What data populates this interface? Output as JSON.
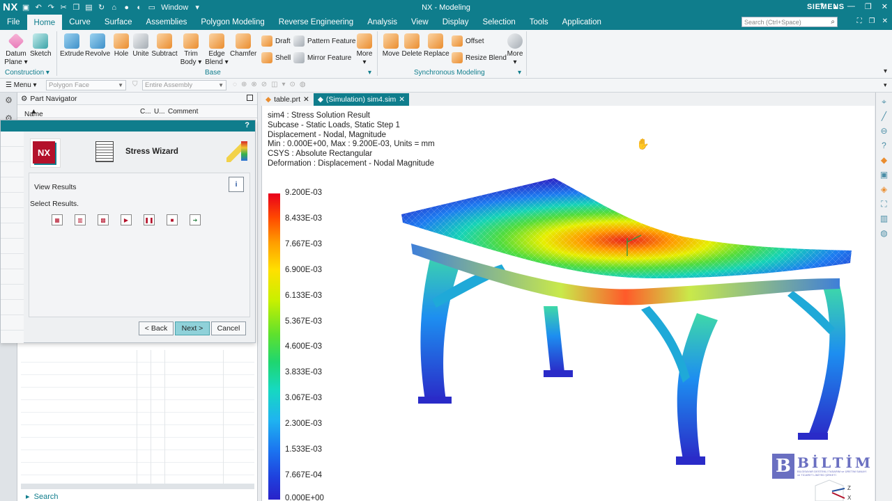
{
  "titlebar": {
    "logo": "NX",
    "window_label": "Window",
    "title": "NX - Modeling",
    "brand": "SIEMENS"
  },
  "menu_tabs": [
    "File",
    "Home",
    "Curve",
    "Surface",
    "Assemblies",
    "Polygon Modeling",
    "Reverse Engineering",
    "Analysis",
    "View",
    "Display",
    "Selection",
    "Tools",
    "Application"
  ],
  "active_tab": "Home",
  "search": {
    "placeholder": "Search (Ctrl+Space)"
  },
  "ribbon": {
    "construction": {
      "datum_plane": "Datum Plane",
      "sketch": "Sketch",
      "group": "Construction"
    },
    "base": {
      "extrude": "Extrude",
      "revolve": "Revolve",
      "hole": "Hole",
      "unite": "Unite",
      "subtract": "Subtract",
      "trim_body": "Trim Body",
      "edge_blend": "Edge Blend",
      "chamfer": "Chamfer",
      "draft": "Draft",
      "shell": "Shell",
      "pattern_feature": "Pattern Feature",
      "mirror_feature": "Mirror Feature",
      "more": "More",
      "group": "Base"
    },
    "sync": {
      "move": "Move",
      "delete": "Delete",
      "replace": "Replace",
      "offset": "Offset",
      "resize_blend": "Resize Blend",
      "more": "More",
      "group": "Synchronous Modeling"
    }
  },
  "toolbar2": {
    "menu": "Menu",
    "filter": "Polygon Face",
    "scope": "Entire Assembly"
  },
  "part_navigator": {
    "title": "Part Navigator",
    "columns": {
      "name": "Name",
      "c": "C...",
      "u": "U...",
      "comment": "Comment"
    },
    "search": "Search"
  },
  "wizard": {
    "nx_logo": "NX",
    "name": "Stress Wizard",
    "help": "?",
    "view_results": "View Results",
    "info": "i",
    "select_results": "Select Results.",
    "buttons": {
      "back": "< Back",
      "next": "Next >",
      "cancel": "Cancel"
    }
  },
  "doc_tabs": [
    {
      "label": "table.prt",
      "active": false
    },
    {
      "label": "(Simulation) sim4.sim",
      "active": true
    }
  ],
  "result_info": [
    "sim4 : Stress Solution Result",
    "Subcase - Static Loads, Static Step 1",
    "Displacement - Nodal, Magnitude",
    "Min : 0.000E+00, Max : 9.200E-03, Units = mm",
    "CSYS : Absolute Rectangular",
    "Deformation : Displacement - Nodal Magnitude"
  ],
  "legend": [
    "9.200E-03",
    "8.433E-03",
    "7.667E-03",
    "6.900E-03",
    "6.133E-03",
    "5.367E-03",
    "4.600E-03",
    "3.833E-03",
    "3.067E-03",
    "2.300E-03",
    "1.533E-03",
    "7.667E-04",
    "0.000E+00"
  ],
  "watermark": {
    "mark": "B",
    "name": "BİLTİM",
    "subtitle": "BİLGİSAYAR DESTEKLİ TASARIM ve ÜRETİM SANAYİ ve TİCARET LİMİTED ŞİRKETİ"
  },
  "triad": {
    "z": "Z",
    "x": "X"
  },
  "colors": {
    "accent": "#0f7d8c",
    "nx_red": "#b3112a"
  }
}
